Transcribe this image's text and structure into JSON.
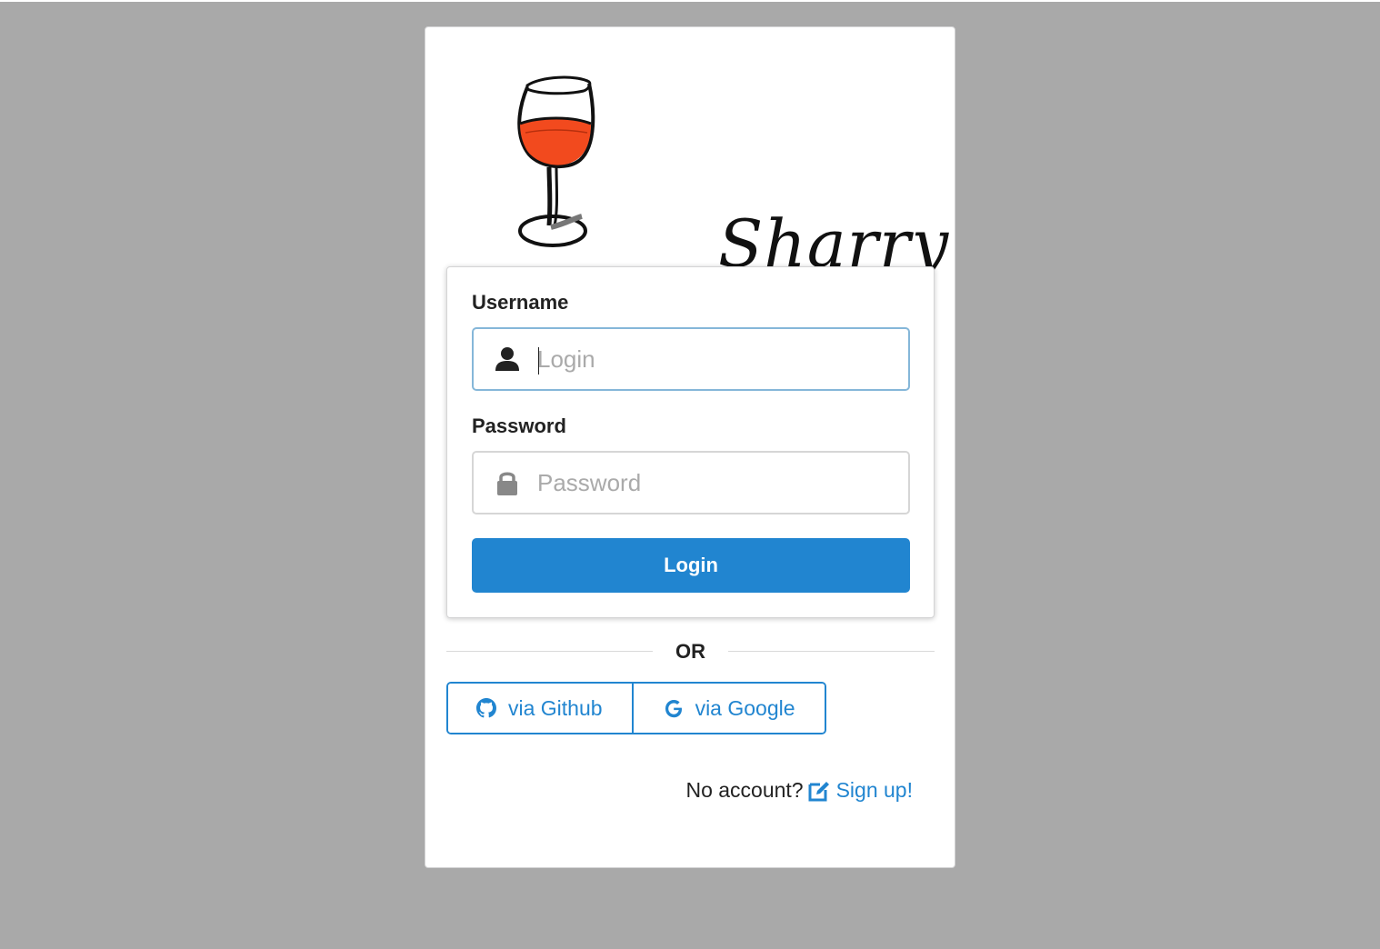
{
  "app": {
    "logo_text": "Sharry"
  },
  "form": {
    "username_label": "Username",
    "username_placeholder": "Login",
    "username_value": "",
    "password_label": "Password",
    "password_placeholder": "Password",
    "password_value": "",
    "login_button": "Login"
  },
  "divider": {
    "text": "OR"
  },
  "oauth": {
    "github_label": "via Github",
    "google_label": "via Google"
  },
  "signup": {
    "question": "No account?",
    "link_label": "Sign up!"
  },
  "colors": {
    "primary": "#2185d0",
    "background": "#a9a9a9",
    "wine": "#f24a1e"
  },
  "icons": {
    "username": "user-icon",
    "password": "lock-icon",
    "github": "github-icon",
    "google": "google-icon",
    "signup": "edit-icon"
  }
}
